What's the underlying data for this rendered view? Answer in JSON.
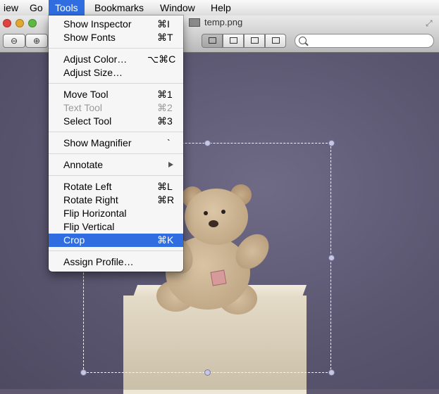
{
  "menubar": {
    "items": [
      {
        "label": "iew"
      },
      {
        "label": "Go"
      },
      {
        "label": "Tools",
        "active": true
      },
      {
        "label": "Bookmarks"
      },
      {
        "label": "Window"
      },
      {
        "label": "Help"
      }
    ]
  },
  "window": {
    "title": "temp.png"
  },
  "tools_menu": {
    "items": [
      {
        "label": "Show Inspector",
        "shortcut": "⌘I"
      },
      {
        "label": "Show Fonts",
        "shortcut": "⌘T"
      },
      {
        "label": "Adjust Color…",
        "shortcut": "⌥⌘C"
      },
      {
        "label": "Adjust Size…",
        "shortcut": ""
      },
      {
        "label": "Move Tool",
        "shortcut": "⌘1"
      },
      {
        "label": "Text Tool",
        "shortcut": "⌘2",
        "disabled": true
      },
      {
        "label": "Select Tool",
        "shortcut": "⌘3"
      },
      {
        "label": "Show Magnifier",
        "shortcut": "`"
      },
      {
        "label": "Annotate",
        "shortcut": "",
        "submenu": true
      },
      {
        "label": "Rotate Left",
        "shortcut": "⌘L"
      },
      {
        "label": "Rotate Right",
        "shortcut": "⌘R"
      },
      {
        "label": "Flip Horizontal",
        "shortcut": ""
      },
      {
        "label": "Flip Vertical",
        "shortcut": ""
      },
      {
        "label": "Crop",
        "shortcut": "⌘K",
        "highlighted": true
      },
      {
        "label": "Assign Profile…",
        "shortcut": ""
      }
    ]
  },
  "colors": {
    "menu_highlight": "#2f6de0",
    "selection_handle": "#c7c7e3"
  }
}
